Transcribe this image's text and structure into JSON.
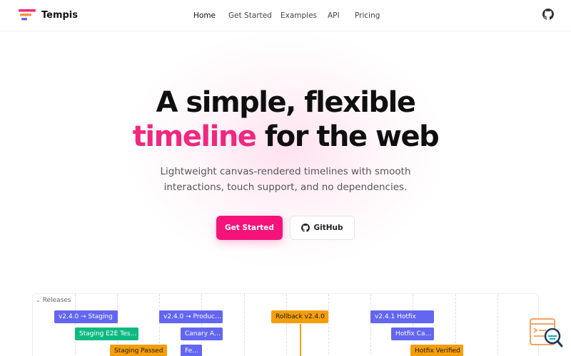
{
  "header": {
    "brand": "Tempis",
    "nav": [
      {
        "label": "Home",
        "active": true
      },
      {
        "label": "Get Started",
        "active": false
      },
      {
        "label": "Examples",
        "active": false
      },
      {
        "label": "API",
        "active": false
      },
      {
        "label": "Pricing",
        "active": false
      }
    ],
    "github_icon": "github-icon"
  },
  "hero": {
    "line1": "A simple, flexible",
    "line2_accent": "timeline",
    "line2_rest": " for the web",
    "subtitle_line1": "Lightweight canvas-rendered timelines with smooth",
    "subtitle_line2": "interactions, touch support, and no dependencies.",
    "primary_button": "Get Started",
    "secondary_button": "GitHub"
  },
  "timeline": {
    "group_label": "Releases",
    "events": [
      {
        "label": "v2.4.0 → Staging",
        "color": "#6366f1"
      },
      {
        "label": "Staging E2E Tes…",
        "color": "#10b981"
      },
      {
        "label": "Staging Passed",
        "color": "#f59e0b"
      },
      {
        "label": "v2.4.0 → Produc…",
        "color": "#6366f1"
      },
      {
        "label": "Canary A…",
        "color": "#6366f1"
      },
      {
        "label": "Fe…",
        "color": "#6366f1"
      },
      {
        "label": "Rollback v2.4.0",
        "color": "#f59e0b"
      },
      {
        "label": "v2.4.1 Hotfix",
        "color": "#6366f1"
      },
      {
        "label": "Hotfix Ca…",
        "color": "#6366f1"
      },
      {
        "label": "Hotfix Verified",
        "color": "#f59e0b"
      }
    ]
  },
  "colors": {
    "accent": "#f0287f",
    "primary_button": "#f5137a",
    "purple": "#6366f1",
    "green": "#10b981",
    "amber": "#f59e0b"
  },
  "widget_icon": "search-document-icon"
}
